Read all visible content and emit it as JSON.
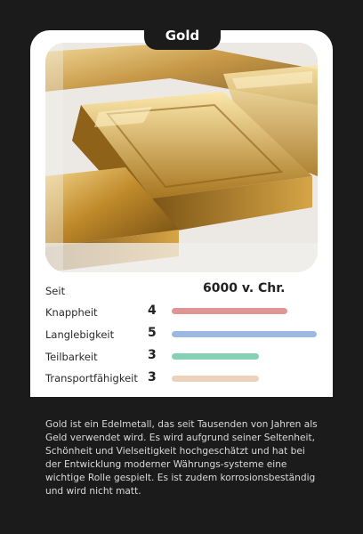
{
  "card": {
    "title": "Gold",
    "photo_icon": "gold-bars-photo",
    "since": {
      "label": "Seit",
      "value": "6000 v. Chr."
    },
    "stats": [
      {
        "label": "Knappheit",
        "value": "4",
        "level": 0.8,
        "color": "#e09595"
      },
      {
        "label": "Langlebigkeit",
        "value": "5",
        "level": 1.0,
        "color": "#9bb8e2"
      },
      {
        "label": "Teilbarkeit",
        "value": "3",
        "level": 0.6,
        "color": "#86d0b3"
      },
      {
        "label": "Transportfähigkeit",
        "value": "3",
        "level": 0.6,
        "color": "#ecd2bc"
      }
    ],
    "description": "Gold ist ein Edelmetall, das seit Tausenden von Jahren als Geld verwendet wird. Es wird aufgrund seiner Seltenheit, Schönheit und Vielseitigkeit hochgeschätzt und hat bei der Entwicklung moderner Währungs-systeme eine wichtige Rolle gespielt. Es ist zudem korrosionsbeständig und wird nicht matt."
  }
}
